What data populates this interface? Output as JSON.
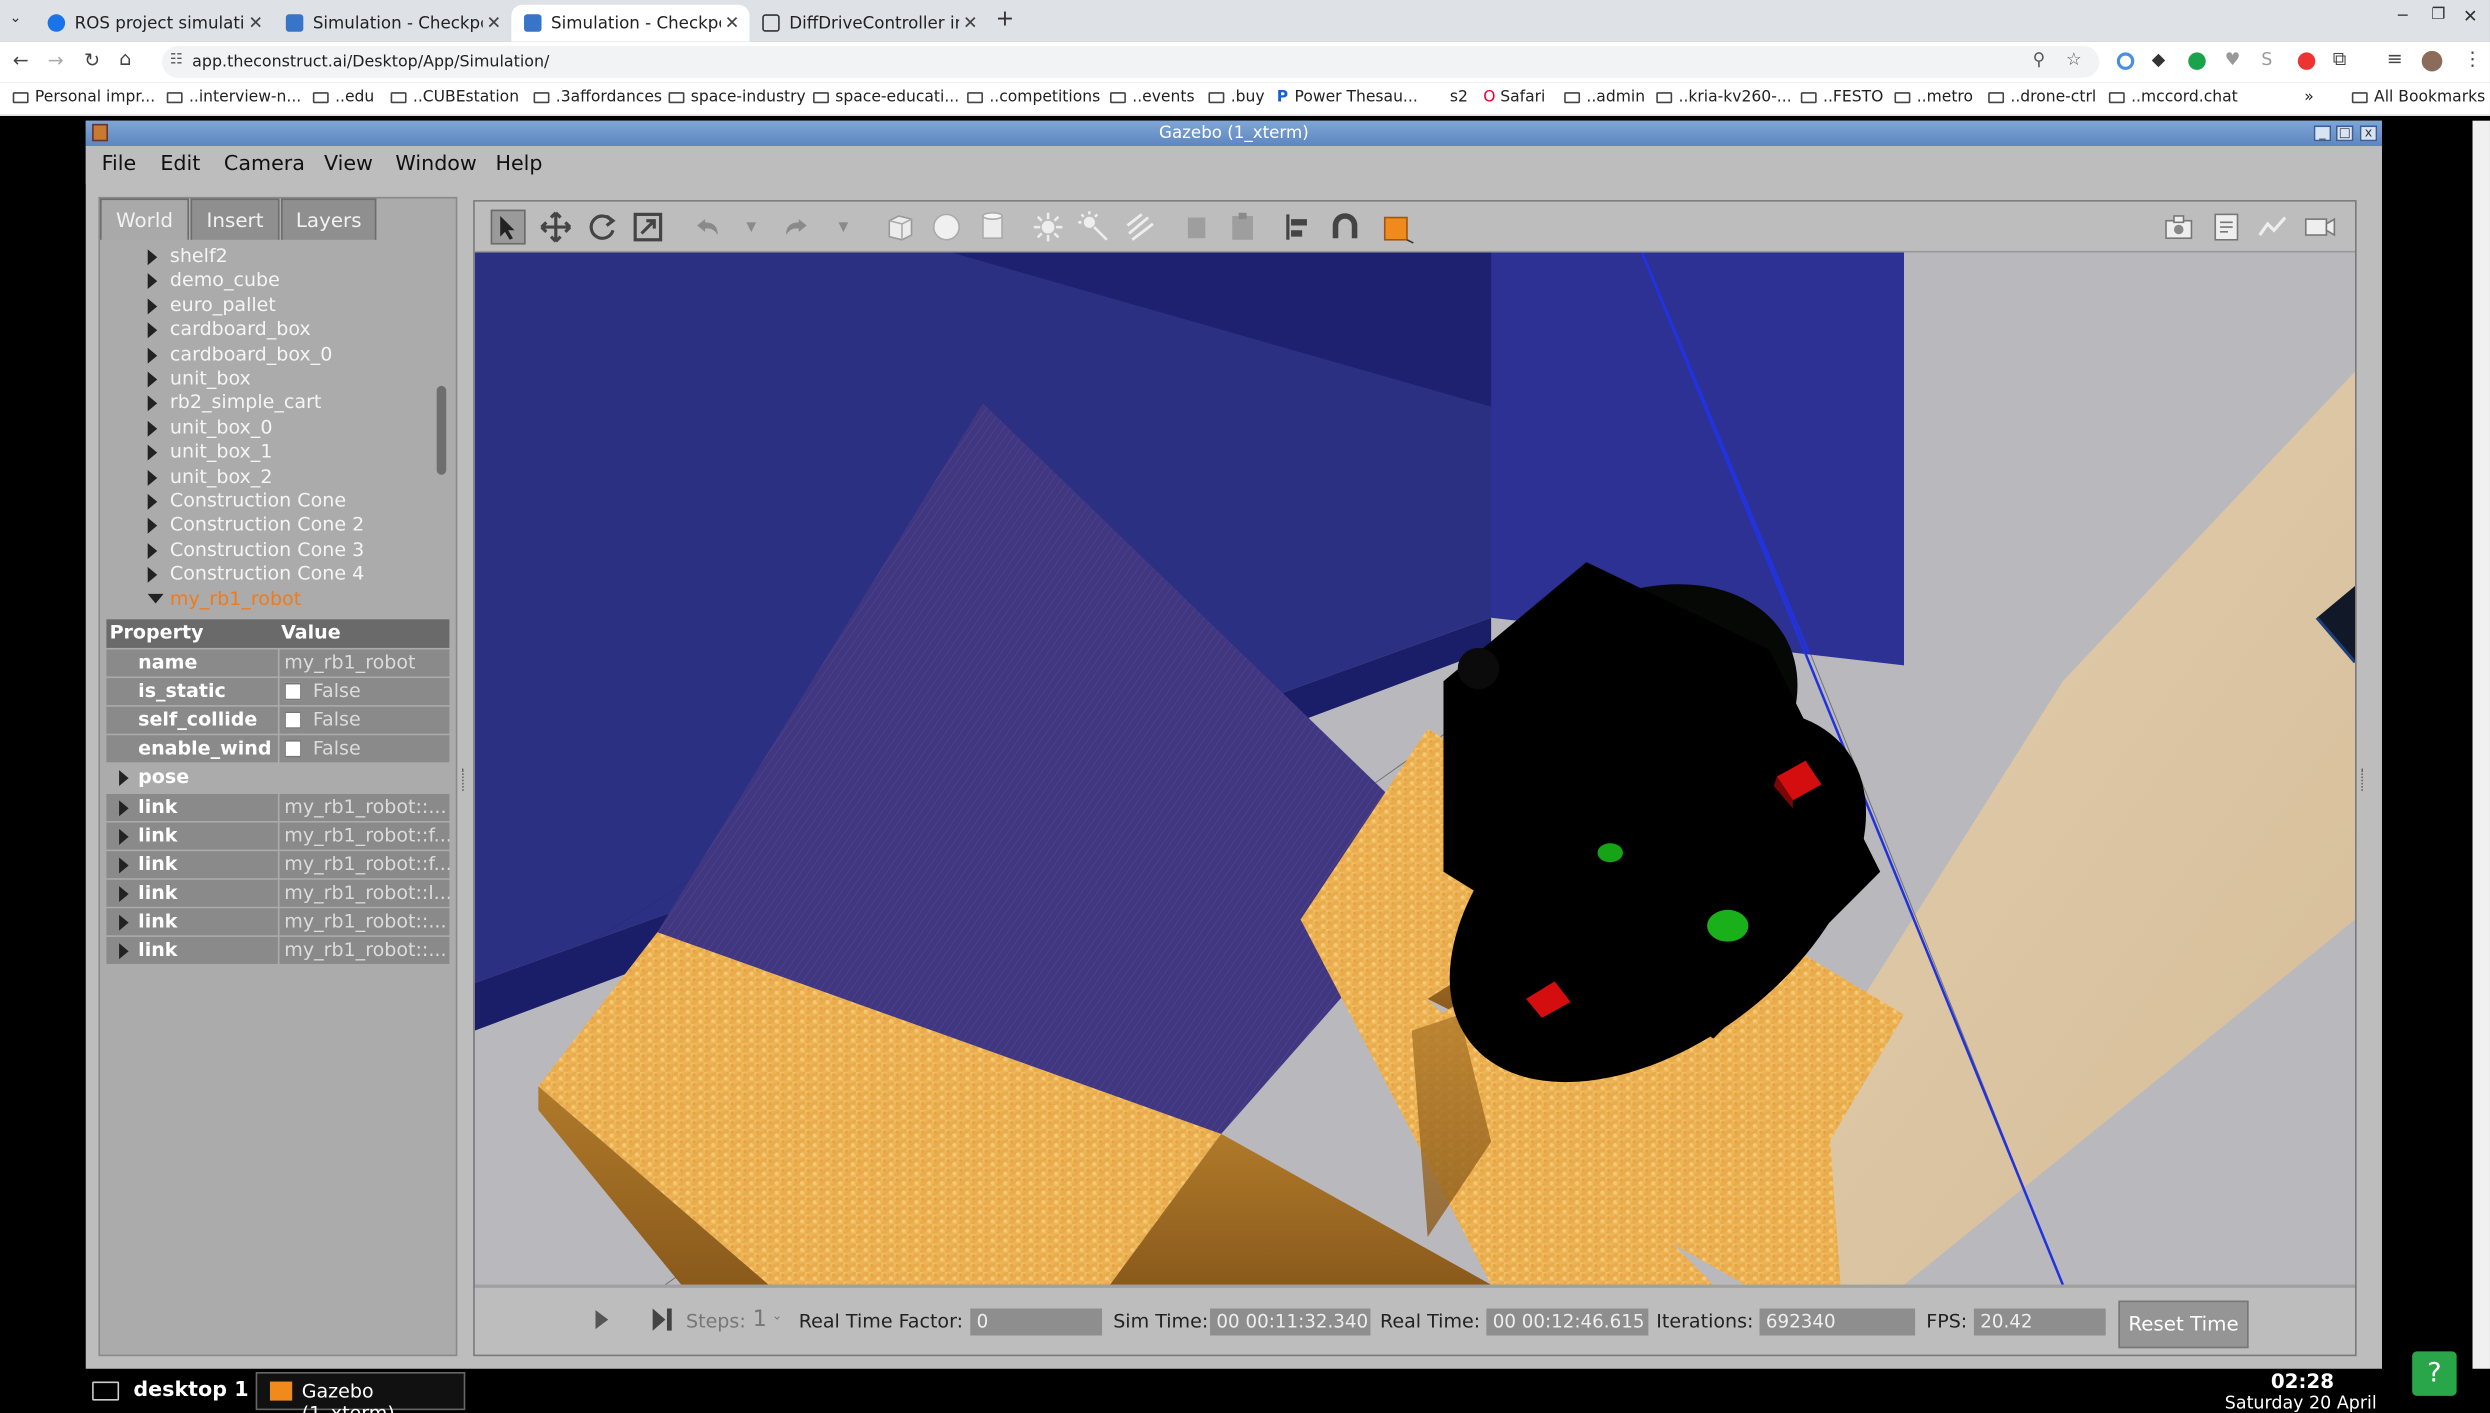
{
  "browser": {
    "tabs": [
      {
        "title": "ROS project simulation",
        "active": false
      },
      {
        "title": "Simulation - Checkpoint",
        "active": false
      },
      {
        "title": "Simulation - Checkpoint",
        "active": true
      },
      {
        "title": "DiffDriveController in C",
        "active": false
      }
    ],
    "url": "app.theconstruct.ai/Desktop/App/Simulation/",
    "bookmarks": [
      "Personal impr...",
      "..interview-n...",
      "..edu",
      "..CUBEstation",
      ".3affordances",
      "space-industry",
      "space-educati...",
      "..competitions",
      "..events",
      ".buy",
      "Power Thesau...",
      "s2",
      "Safari",
      "..admin",
      "..kria-kv260-...",
      "..FESTO",
      "..metro",
      "..drone-ctrl",
      "..mccord.chat"
    ],
    "all_bookmarks": "All Bookmarks"
  },
  "gazebo": {
    "window_title": "Gazebo (1_xterm)",
    "menu": [
      "File",
      "Edit",
      "Camera",
      "View",
      "Window",
      "Help"
    ],
    "panel_tabs": [
      "World",
      "Insert",
      "Layers"
    ],
    "tree": [
      "shelf2",
      "demo_cube",
      "euro_pallet",
      "cardboard_box",
      "cardboard_box_0",
      "unit_box",
      "rb2_simple_cart",
      "unit_box_0",
      "unit_box_1",
      "unit_box_2",
      "Construction Cone",
      "Construction Cone 2",
      "Construction Cone 3",
      "Construction Cone 4"
    ],
    "tree_selected": "my_rb1_robot",
    "props": {
      "header_property": "Property",
      "header_value": "Value",
      "rows": [
        {
          "k": "name",
          "v": "my_rb1_robot"
        },
        {
          "k": "is_static",
          "v": "False"
        },
        {
          "k": "self_collide",
          "v": "False"
        },
        {
          "k": "enable_wind",
          "v": "False"
        }
      ],
      "pose": "pose",
      "links": [
        {
          "k": "link",
          "v": "my_rb1_robot::..."
        },
        {
          "k": "link",
          "v": "my_rb1_robot::f..."
        },
        {
          "k": "link",
          "v": "my_rb1_robot::f..."
        },
        {
          "k": "link",
          "v": "my_rb1_robot::l..."
        },
        {
          "k": "link",
          "v": "my_rb1_robot::..."
        },
        {
          "k": "link",
          "v": "my_rb1_robot::..."
        }
      ]
    },
    "bottom": {
      "steps_label": "Steps:",
      "steps_value": "1",
      "rtf_label": "Real Time Factor:",
      "rtf_value": "0",
      "sim_label": "Sim Time:",
      "sim_value": "00 00:11:32.340",
      "real_label": "Real Time:",
      "real_value": "00 00:12:46.615",
      "iter_label": "Iterations:",
      "iter_value": "692340",
      "fps_label": "FPS:",
      "fps_value": "20.42",
      "reset": "Reset Time"
    }
  },
  "taskbar": {
    "desktop": "desktop 1",
    "app": "Gazebo (1_xterm)",
    "time": "02:28",
    "date": "Saturday 20 April",
    "help": "?"
  }
}
